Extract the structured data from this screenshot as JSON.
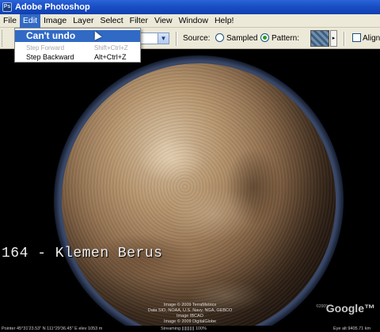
{
  "app": {
    "title": "Adobe Photoshop",
    "icon_text": "Ps"
  },
  "menubar": {
    "items": [
      "File",
      "Edit",
      "Image",
      "Layer",
      "Select",
      "Filter",
      "View",
      "Window",
      "Help!"
    ],
    "active_index": 1
  },
  "edit_menu": {
    "items": [
      {
        "label": "Can't undo",
        "shortcut": "",
        "state": "highlighted"
      },
      {
        "label": "Step Forward",
        "shortcut": "Shift+Ctrl+Z",
        "state": "disabled"
      },
      {
        "label": "Step Backward",
        "shortcut": "Alt+Ctrl+Z",
        "state": "normal"
      }
    ]
  },
  "options": {
    "dropdown_arrow": "▼",
    "source_label": "Source:",
    "sampled_label": "Sampled",
    "pattern_label": "Pattern:",
    "aligned_label": "Aligned",
    "pattern_arrow": "▸",
    "selected_source": "Pattern"
  },
  "overlay": {
    "caption": "164 - Klemen Berus"
  },
  "credits": {
    "lines": [
      "Image © 2009 TerraMetrics",
      "Data SIO, NOAA, U.S. Navy, NGA, GEBCO",
      "Image IBCAO",
      "Image © 2009 DigitalGlobe"
    ],
    "google_small": "©2009",
    "google_logo": "Google™"
  },
  "status": {
    "pointer": "Pointer  45°31'23.53\" N  111°29'36.45\" E  elev 1053 m",
    "streaming": "Streaming ||||||||||| 100%",
    "eye_alt": "Eye alt  9405.71 km"
  },
  "colors": {
    "titlebar": "#1a4fc4",
    "menu_highlight": "#316ac5",
    "chrome": "#ece9d8"
  }
}
